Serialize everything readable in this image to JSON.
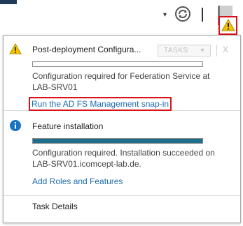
{
  "toolbar": {
    "caret_glyph": "▾",
    "refresh_icon": "refresh-icon",
    "flag_icon": "notification-flag-icon",
    "warning_icon": "warning-icon"
  },
  "notifications": [
    {
      "icon": "warning-icon",
      "title": "Post-deployment Configura...",
      "tasks_label": "TASKS",
      "close_label": "X",
      "progress": 0,
      "description": "Configuration required for Federation Service at LAB-SRV01",
      "link": "Run the AD FS Management snap-in"
    },
    {
      "icon": "info-icon",
      "title": "Feature installation",
      "progress": 1.0,
      "description": "Configuration required. Installation succeeded on LAB-SRV01.icomcept-lab.de.",
      "link": "Add Roles and Features"
    }
  ],
  "footer": {
    "task_details": "Task Details"
  },
  "colors": {
    "accent_link": "#1d6cae",
    "highlight_red": "#d8121a",
    "progress_fill": "#1e6f8c",
    "warning_yellow": "#f2c200"
  }
}
